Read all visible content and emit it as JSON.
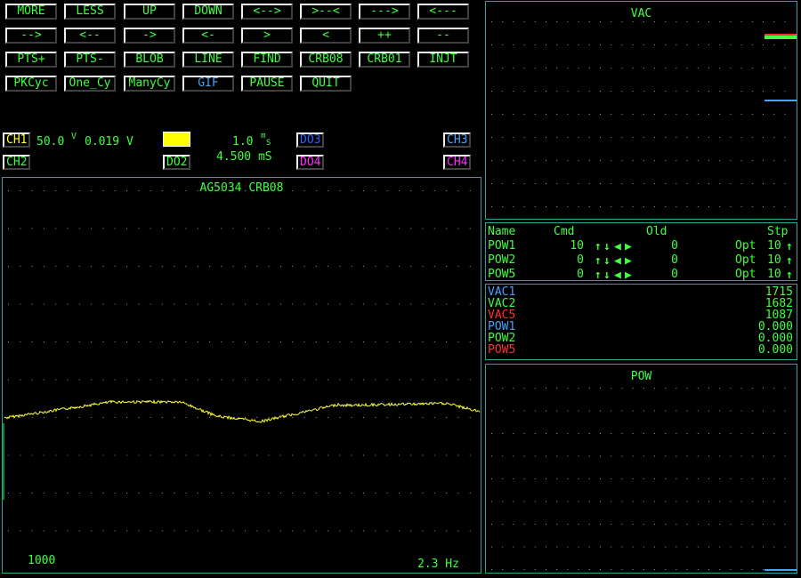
{
  "toolbar": {
    "buttons": [
      {
        "label": "MORE"
      },
      {
        "label": "LESS"
      },
      {
        "label": "UP"
      },
      {
        "label": "DOWN"
      },
      {
        "label": "<-->"
      },
      {
        "label": ">--<"
      },
      {
        "label": "--->"
      },
      {
        "label": "<---"
      },
      {
        "label": "-->"
      },
      {
        "label": "<--"
      },
      {
        "label": "->"
      },
      {
        "label": "<-"
      },
      {
        "label": ">"
      },
      {
        "label": "<"
      },
      {
        "label": "++"
      },
      {
        "label": "--"
      },
      {
        "label": "PTS+"
      },
      {
        "label": "PTS-"
      },
      {
        "label": "BLOB"
      },
      {
        "label": "LINE"
      },
      {
        "label": "FIND"
      },
      {
        "label": "CRB08"
      },
      {
        "label": "CRB01"
      },
      {
        "label": "INJT"
      },
      {
        "label": "PKCyc"
      },
      {
        "label": "One_Cy"
      },
      {
        "label": "ManyCy"
      },
      {
        "label": "GIF"
      },
      {
        "label": "PAUSE"
      },
      {
        "label": "QUIT"
      }
    ]
  },
  "channels": {
    "ch1": "CH1",
    "ch2": "CH2",
    "ch3": "CH3",
    "ch4": "CH4",
    "do2": "DO2",
    "do3": "DO3",
    "do4": "DO4",
    "ch1_scale": "50.0",
    "ch1_unit_top": "V",
    "ch1_offset": "0.019 V",
    "timebase": "1.0",
    "timebase_unit_top": "m",
    "timebase_unit_bottom": "S",
    "delay": "4.500 mS"
  },
  "scope": {
    "title": "AG5034 CRB08",
    "points_label": "1000",
    "freq_label": "2.3 Hz"
  },
  "vac_panel": {
    "title": "VAC"
  },
  "pow_panel": {
    "title": "POW"
  },
  "controls": {
    "headers": {
      "name": "Name",
      "cmd": "Cmd",
      "old": "Old",
      "stp": "Stp"
    },
    "rows": [
      {
        "name": "POW1",
        "cmd": "10",
        "old": "0",
        "opt": "Opt",
        "stp": "10"
      },
      {
        "name": "POW2",
        "cmd": "0",
        "old": "0",
        "opt": "Opt",
        "stp": "10"
      },
      {
        "name": "POW5",
        "cmd": "0",
        "old": "0",
        "opt": "Opt",
        "stp": "10"
      }
    ]
  },
  "readouts": [
    {
      "name": "VAC1",
      "value": "1715",
      "color": "#4aa0ff"
    },
    {
      "name": "VAC2",
      "value": "1682",
      "color": "#40ff40"
    },
    {
      "name": "VAC5",
      "value": "1087",
      "color": "#ff3030"
    },
    {
      "name": "POW1",
      "value": "0.000",
      "color": "#4aa0ff"
    },
    {
      "name": "POW2",
      "value": "0.000",
      "color": "#40ff40"
    },
    {
      "name": "POW5",
      "value": "0.000",
      "color": "#ff3030"
    }
  ],
  "colors": {
    "grid_border": "#2ea0a0",
    "button_text": "#40ff40",
    "trace": "#ffff30",
    "ch1": "#ffff30",
    "ch2": "#40ff40",
    "ch3": "#4aa0ff",
    "ch4": "#ff30ff"
  }
}
